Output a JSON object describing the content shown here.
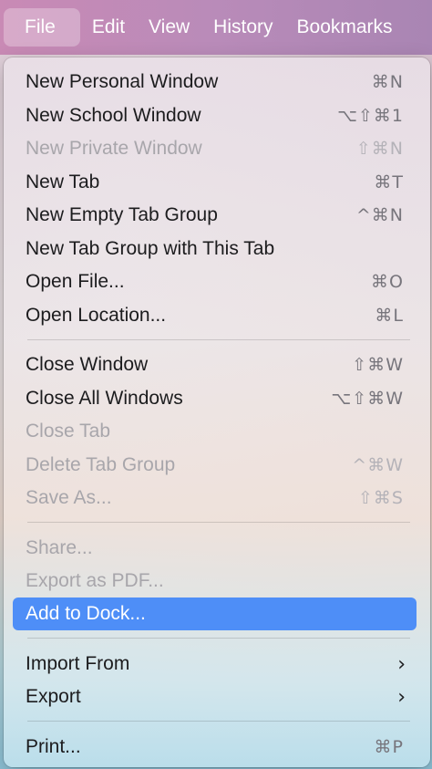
{
  "menubar": {
    "items": [
      "File",
      "Edit",
      "View",
      "History",
      "Bookmarks"
    ]
  },
  "file_menu": {
    "new_personal_window": {
      "label": "New Personal Window",
      "shortcut": "⌘N"
    },
    "new_school_window": {
      "label": "New School Window",
      "shortcut": "⌥⇧⌘1"
    },
    "new_private_window": {
      "label": "New Private Window",
      "shortcut": "⇧⌘N"
    },
    "new_tab": {
      "label": "New Tab",
      "shortcut": "⌘T"
    },
    "new_empty_tab_group": {
      "label": "New Empty Tab Group",
      "shortcut": "^⌘N"
    },
    "new_tab_group_with_this_tab": {
      "label": "New Tab Group with This Tab"
    },
    "open_file": {
      "label": "Open File...",
      "shortcut": "⌘O"
    },
    "open_location": {
      "label": "Open Location...",
      "shortcut": "⌘L"
    },
    "close_window": {
      "label": "Close Window",
      "shortcut": "⇧⌘W"
    },
    "close_all_windows": {
      "label": "Close All Windows",
      "shortcut": "⌥⇧⌘W"
    },
    "close_tab": {
      "label": "Close Tab"
    },
    "delete_tab_group": {
      "label": "Delete Tab Group",
      "shortcut": "^⌘W"
    },
    "save_as": {
      "label": "Save As...",
      "shortcut": "⇧⌘S"
    },
    "share": {
      "label": "Share..."
    },
    "export_as_pdf": {
      "label": "Export as PDF..."
    },
    "add_to_dock": {
      "label": "Add to Dock..."
    },
    "import_from": {
      "label": "Import From"
    },
    "export": {
      "label": "Export"
    },
    "print": {
      "label": "Print...",
      "shortcut": "⌘P"
    }
  },
  "colors": {
    "highlight": "#4e8ef7",
    "disabled_text": "#a8a6ab"
  }
}
